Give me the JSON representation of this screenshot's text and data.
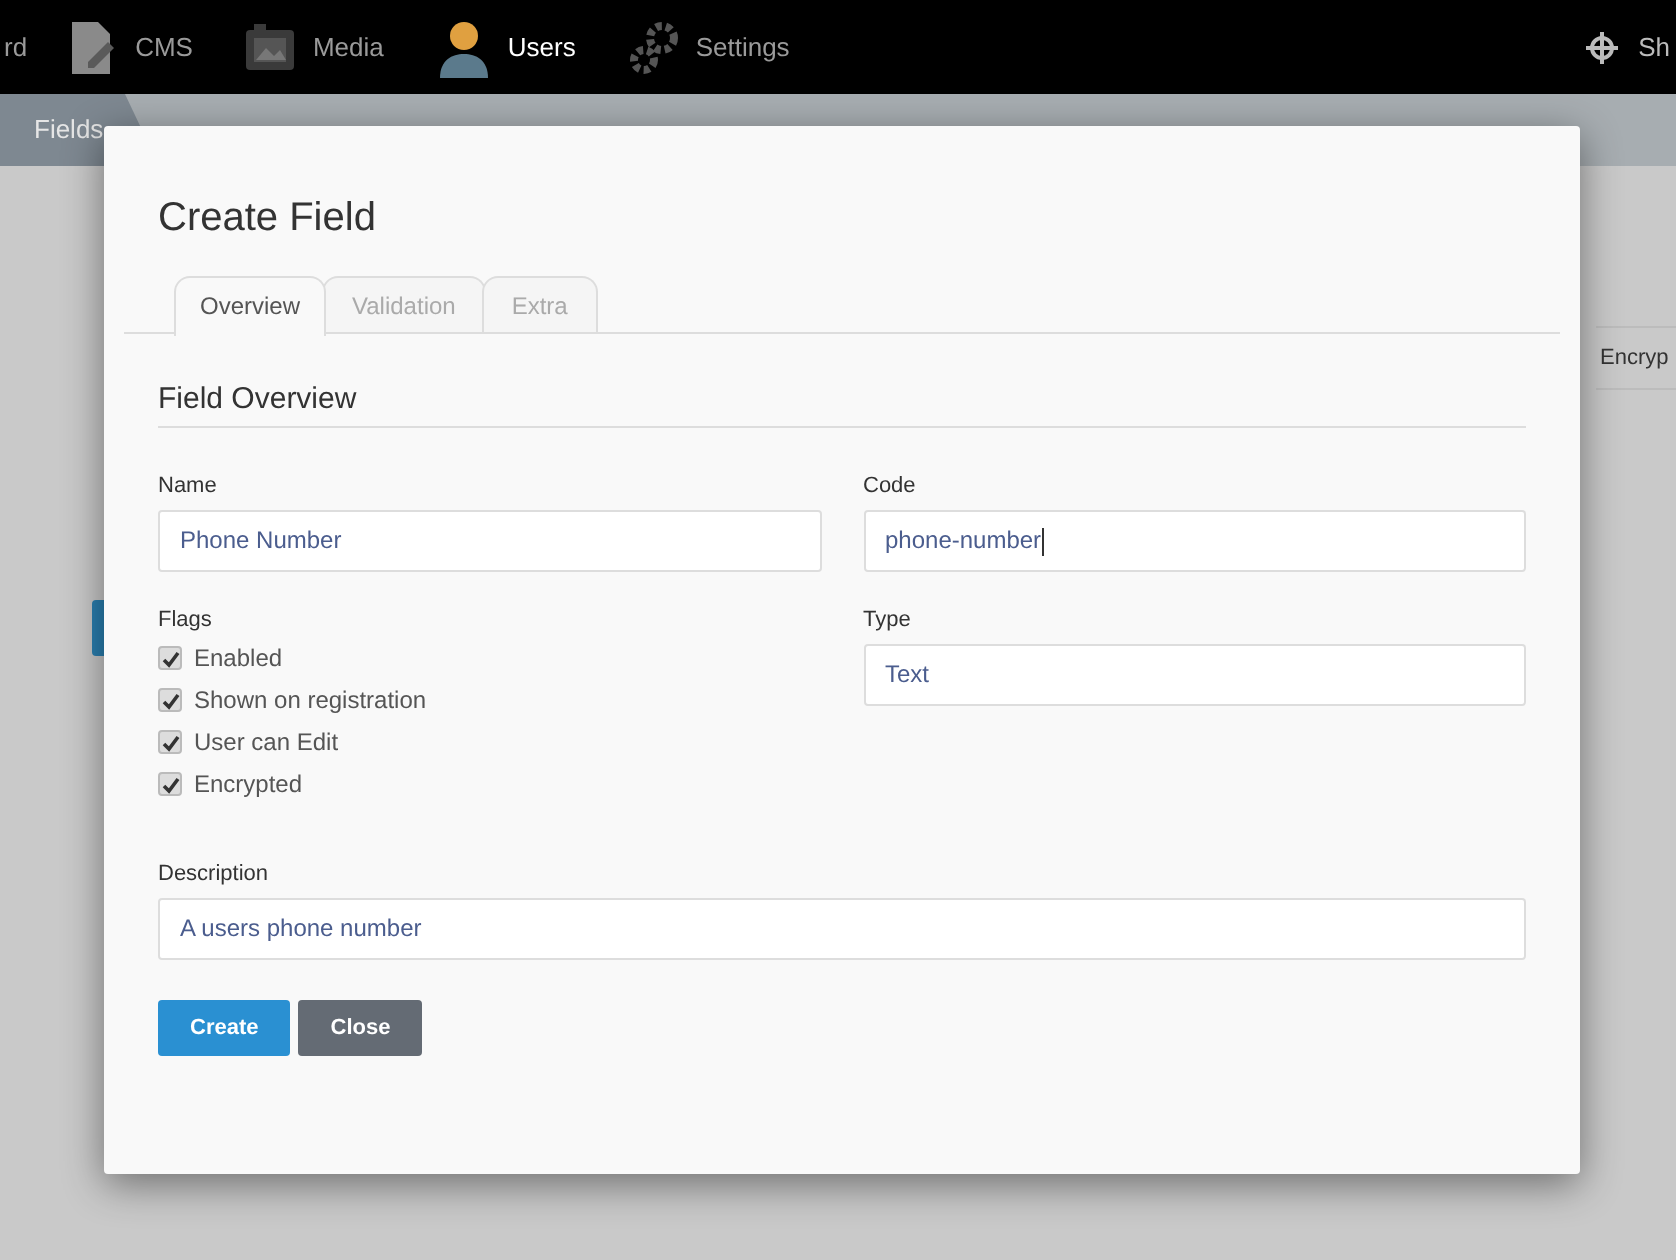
{
  "nav": {
    "items": [
      {
        "label": "rd",
        "selected": false
      },
      {
        "label": "CMS",
        "selected": false
      },
      {
        "label": "Media",
        "selected": false
      },
      {
        "label": "Users",
        "selected": true
      },
      {
        "label": "Settings",
        "selected": false
      }
    ],
    "right": {
      "label": "Sh"
    }
  },
  "breadcrumb": {
    "items": [
      "Fields"
    ]
  },
  "background": {
    "table_cell": "Encryp"
  },
  "modal": {
    "title": "Create Field",
    "tabs": [
      {
        "label": "Overview",
        "selected": true
      },
      {
        "label": "Validation",
        "selected": false
      },
      {
        "label": "Extra",
        "selected": false
      }
    ],
    "section_title": "Field Overview",
    "name": {
      "label": "Name",
      "value": "Phone Number"
    },
    "code": {
      "label": "Code",
      "value": "phone-number",
      "focused": true
    },
    "flags": {
      "label": "Flags",
      "items": [
        {
          "label": "Enabled",
          "checked": true
        },
        {
          "label": "Shown on registration",
          "checked": true
        },
        {
          "label": "User can Edit",
          "checked": true
        },
        {
          "label": "Encrypted",
          "checked": true
        }
      ]
    },
    "type": {
      "label": "Type",
      "value": "Text"
    },
    "description": {
      "label": "Description",
      "value": "A users phone number"
    },
    "buttons": [
      {
        "label": "Create",
        "kind": "primary"
      },
      {
        "label": "Close",
        "kind": "secondary"
      }
    ]
  }
}
